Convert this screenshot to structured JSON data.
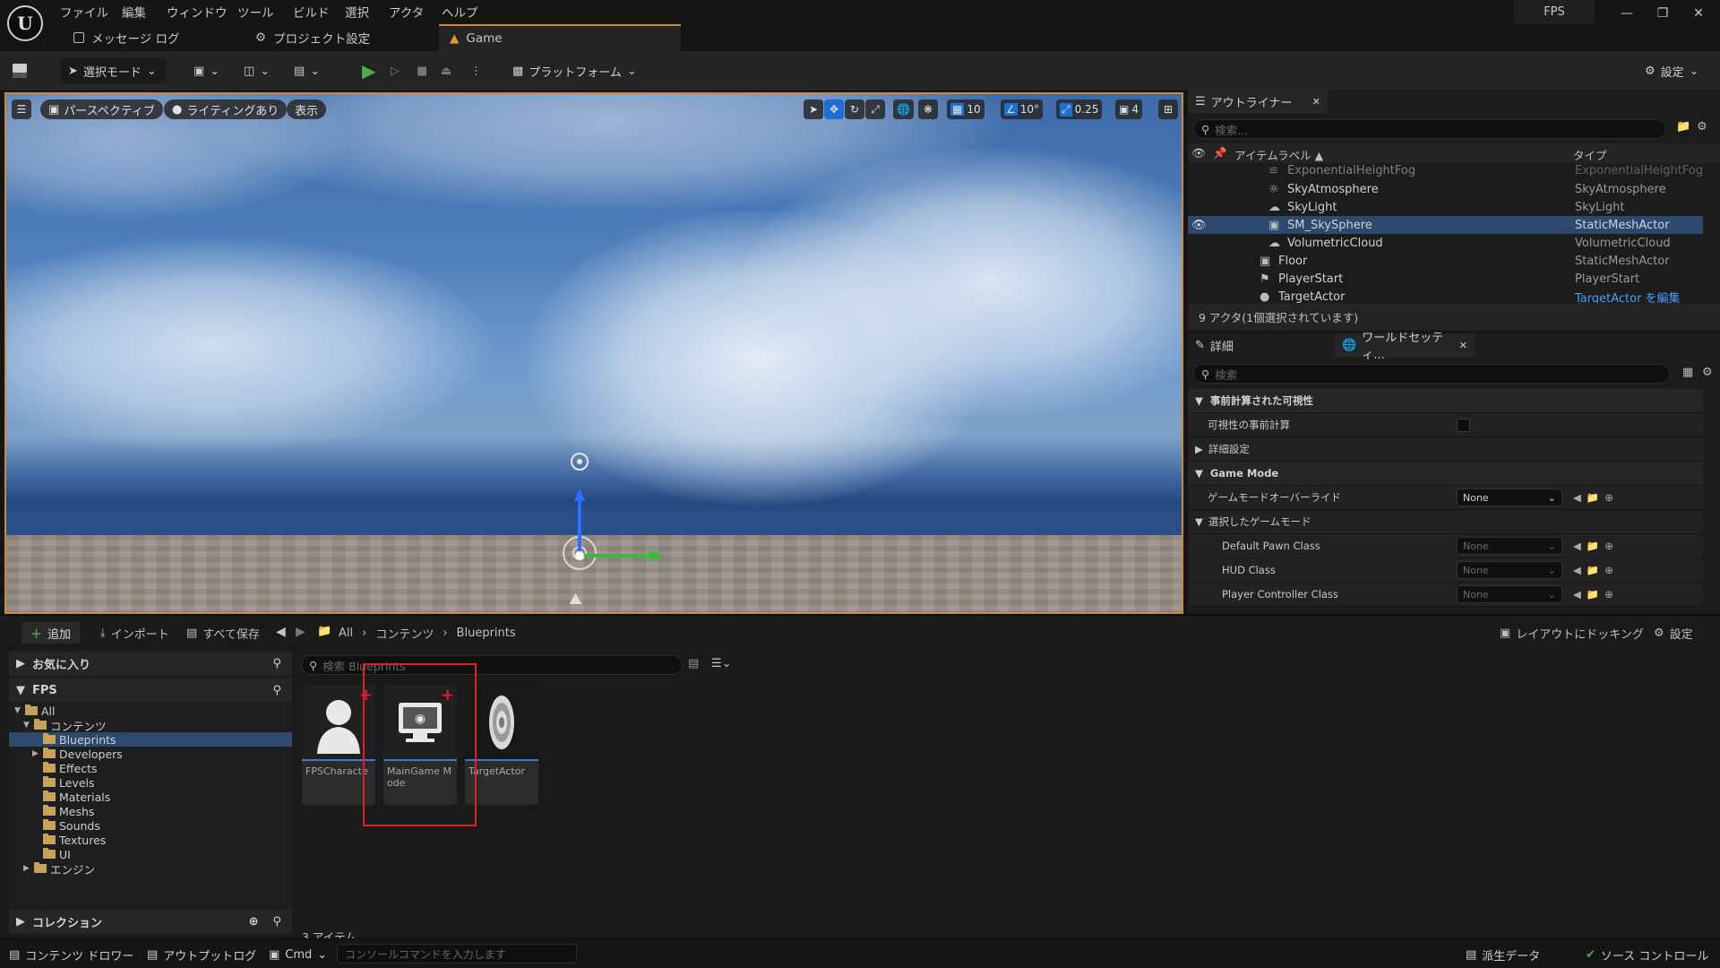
{
  "app": {
    "project_name": "FPS"
  },
  "menu": [
    "ファイル",
    "編集",
    "ウィンドウ",
    "ツール",
    "ビルド",
    "選択",
    "アクタ",
    "ヘルプ"
  ],
  "doc_tabs": {
    "message_log": "メッセージ ログ",
    "project_settings": "プロジェクト設定",
    "game": "Game"
  },
  "toolbar": {
    "select_mode": "選択モード",
    "platform": "プラットフォーム",
    "settings": "設定"
  },
  "viewport": {
    "perspective": "パースペクティブ",
    "lighting": "ライティングあり",
    "show": "表示",
    "grid_snap": "10",
    "rotation_snap": "10°",
    "scale_snap": "0.25",
    "camera_speed": "4"
  },
  "outliner": {
    "tab": "アウトライナー",
    "search_placeholder": "検索...",
    "col_label": "アイテムラベル ▲",
    "col_type": "タイプ",
    "rows": [
      {
        "label": "ExponentialHeightFog",
        "type": "ExponentialHeightFog",
        "selected": false
      },
      {
        "label": "SkyAtmosphere",
        "type": "SkyAtmosphere",
        "selected": false
      },
      {
        "label": "SkyLight",
        "type": "SkyLight",
        "selected": false
      },
      {
        "label": "SM_SkySphere",
        "type": "StaticMeshActor",
        "selected": true
      },
      {
        "label": "VolumetricCloud",
        "type": "VolumetricCloud",
        "selected": false
      },
      {
        "label": "Floor",
        "type": "StaticMeshActor",
        "selected": false
      },
      {
        "label": "PlayerStart",
        "type": "PlayerStart",
        "selected": false
      },
      {
        "label": "TargetActor",
        "type": "TargetActor を編集",
        "selected": false
      }
    ],
    "status": "9 アクタ(1個選択されています)"
  },
  "details": {
    "tab_details": "詳細",
    "tab_world": "ワールドセッティ...",
    "search_placeholder": "検索",
    "cat_precomputed": "事前計算された可視性",
    "precompute_visibility": "可視性の事前計算",
    "advanced": "詳細設定",
    "cat_game_mode": "Game Mode",
    "game_mode_override": "ゲームモードオーバーライド",
    "none": "None",
    "selected_game_mode": "選択したゲームモード",
    "default_pawn": "Default Pawn Class",
    "hud_class": "HUD Class",
    "player_controller": "Player Controller Class"
  },
  "content_browser": {
    "add": "追加",
    "import": "インポート",
    "save_all": "すべて保存",
    "breadcrumb": [
      "All",
      "コンテンツ",
      "Blueprints"
    ],
    "dock": "レイアウトにドッキング",
    "settings": "設定",
    "favorites": "お気に入り",
    "project": "FPS",
    "search_placeholder": "検索 Blueprints",
    "tree": [
      {
        "label": "All",
        "depth": 0,
        "open": true
      },
      {
        "label": "コンテンツ",
        "depth": 1,
        "open": true
      },
      {
        "label": "Blueprints",
        "depth": 2,
        "selected": true
      },
      {
        "label": "Developers",
        "depth": 2,
        "arrow": true
      },
      {
        "label": "Effects",
        "depth": 2
      },
      {
        "label": "Levels",
        "depth": 2
      },
      {
        "label": "Materials",
        "depth": 2
      },
      {
        "label": "Meshs",
        "depth": 2
      },
      {
        "label": "Sounds",
        "depth": 2
      },
      {
        "label": "Textures",
        "depth": 2
      },
      {
        "label": "UI",
        "depth": 2
      },
      {
        "label": "エンジン",
        "depth": 1,
        "arrow": true
      }
    ],
    "collections": "コレクション",
    "assets": [
      {
        "name": "FPSCharacter",
        "display": "FPSCharacte"
      },
      {
        "name": "MainGameMode",
        "display": "MainGame Mode"
      },
      {
        "name": "TargetActor",
        "display": "TargetActor"
      }
    ],
    "count": "3 アイテム"
  },
  "statusbar": {
    "content_drawer": "コンテンツ ドロワー",
    "output_log": "アウトプットログ",
    "cmd": "Cmd",
    "console_placeholder": "コンソールコマンドを入力します",
    "derived_data": "派生データ",
    "source_control": "ソース コントロール"
  },
  "colors": {
    "accent_select": "#2d4a6e",
    "viewport_border": "#d08a2a",
    "play_green": "#4caf50",
    "highlight_red": "#e02020"
  }
}
